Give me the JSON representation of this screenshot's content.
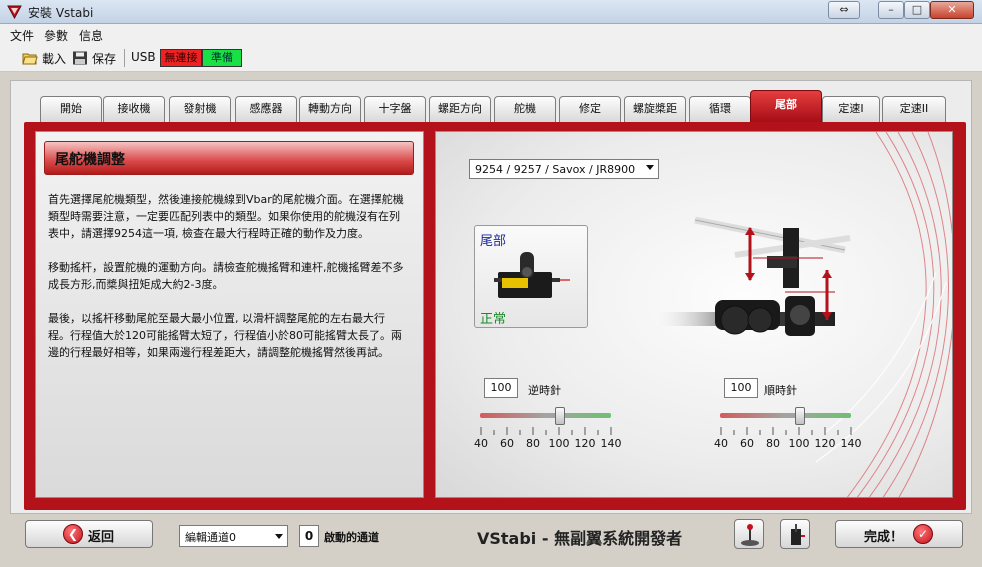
{
  "window": {
    "title": "安裝 Vstabi",
    "icon": "vstabi-logo-icon"
  },
  "menu": [
    "文件",
    "參數",
    "信息"
  ],
  "toolbar": {
    "load_label": "載入",
    "save_label": "保存",
    "usb_label": "USB",
    "conn_status": "無連接",
    "ready_status": "準備",
    "colors": {
      "conn": "#ee2222",
      "ready": "#19e045"
    }
  },
  "tabs": [
    {
      "label": "開始"
    },
    {
      "label": "接收機"
    },
    {
      "label": "發射機"
    },
    {
      "label": "感應器"
    },
    {
      "label": "轉動方向"
    },
    {
      "label": "十字盤"
    },
    {
      "label": "螺距方向"
    },
    {
      "label": "舵機"
    },
    {
      "label": "修定"
    },
    {
      "label": "螺旋槳距"
    },
    {
      "label": "循環"
    },
    {
      "label": "尾部"
    },
    {
      "label": "定速I"
    },
    {
      "label": "定速II"
    }
  ],
  "active_tab": "尾部",
  "left": {
    "title": "尾舵機調整",
    "p1_lines": [
      "首先選擇尾舵機類型，然後連接舵機線到Vbar的尾舵機介面。在選擇舵機",
      "類型時需要注意，一定要匹配列表中的類型。如果你使用的舵機沒有在列",
      "表中，請選擇9254這一項, 檢查在最大行程時正確的動作及力度。"
    ],
    "p2_lines": [
      "移動搖杆，設置舵機的運動方向。請檢查舵機搖臂和連杆,舵機搖臂差不多",
      "成長方形,而槳與扭矩成大約2-3度。"
    ],
    "p3_lines": [
      "最後，以搖杆移動尾舵至最大最小位置, 以滑杆調整尾舵的左右最大行",
      "程。行程值大於120可能搖臂太短了，行程值小於80可能搖臂太長了。兩",
      "邊的行程最好相等，如果兩邊行程差距大，請調整舵機搖臂然後再試。"
    ]
  },
  "right": {
    "servo_select": "9254 / 9257 / Savox / JR8900",
    "servo_box_top": "尾部",
    "servo_box_bottom": "正常",
    "ccw": {
      "value": "100",
      "label": "逆時針",
      "level": 100
    },
    "cw": {
      "value": "100",
      "label": "順時針",
      "level": 100
    },
    "scale": [
      "40",
      "60",
      "80",
      "100",
      "120",
      "140"
    ]
  },
  "bottom": {
    "back_label": "返回",
    "channel_select": "編輯通道0",
    "active_count": "0",
    "active_label": "啟動的通道",
    "brand": "VStabi - 無副翼系統開發者",
    "finish_label": "完成！"
  }
}
